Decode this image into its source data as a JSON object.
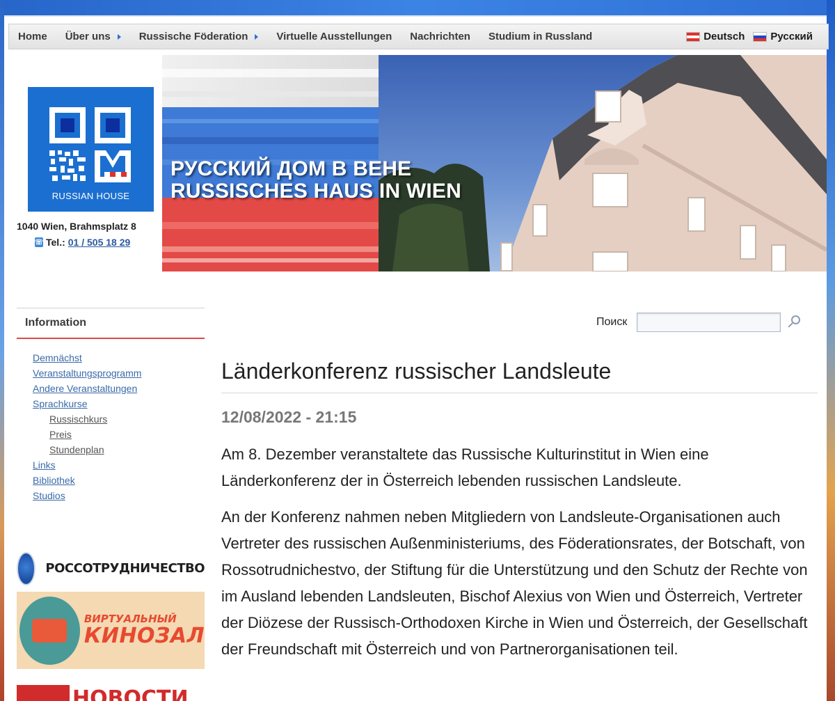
{
  "nav": {
    "items": [
      {
        "label": "Home",
        "has_submenu": false
      },
      {
        "label": "Über uns",
        "has_submenu": true
      },
      {
        "label": "Russische Föderation",
        "has_submenu": true
      },
      {
        "label": "Virtuelle Ausstellungen",
        "has_submenu": false
      },
      {
        "label": "Nachrichten",
        "has_submenu": false
      },
      {
        "label": "Studium in Russland",
        "has_submenu": false
      }
    ],
    "languages": [
      {
        "label": "Deutsch",
        "flag_colors": [
          "#e0312c",
          "#ffffff",
          "#e0312c"
        ]
      },
      {
        "label": "Русский",
        "flag_colors": [
          "#ffffff",
          "#1f46c8",
          "#e0312c"
        ]
      }
    ]
  },
  "header": {
    "logo_text": "RUSSIAN HOUSE",
    "address": "1040 Wien, Brahmsplatz 8",
    "tel_label": "Tel.:",
    "tel_number": "01 / 505 18 29",
    "banner_line1": "РУССКИЙ ДОМ В ВЕНЕ",
    "banner_line2": "RUSSISCHES HAUS IN WIEN"
  },
  "sidebar": {
    "heading": "Information",
    "links": [
      {
        "label": "Demnächst",
        "sub": false
      },
      {
        "label": "Veranstaltungsprogramm",
        "sub": false
      },
      {
        "label": "Andere Veranstaltungen",
        "sub": false
      },
      {
        "label": "Sprachkurse",
        "sub": false
      },
      {
        "label": "Russischkurs",
        "sub": true
      },
      {
        "label": "Preis",
        "sub": true
      },
      {
        "label": "Stundenplan",
        "sub": true
      },
      {
        "label": "Links",
        "sub": false
      },
      {
        "label": "Bibliothek",
        "sub": false
      },
      {
        "label": "Studios",
        "sub": false
      }
    ],
    "partners": {
      "rossotrud": "РОССОТРУДНИЧЕСТВО",
      "kino_line1": "ВИРТУАЛЬНЫЙ",
      "kino_line2": "КИНОЗАЛ",
      "novosti": "НОВОСТИ"
    }
  },
  "search": {
    "label": "Поиск",
    "value": ""
  },
  "article": {
    "title": "Länderkonferenz russischer Landsleute",
    "date": "12/08/2022 - 21:15",
    "paragraphs": [
      "Am 8. Dezember veranstaltete das Russische Kulturinstitut in Wien eine Länderkonferenz der in Österreich lebenden russischen Landsleute.",
      "An der Konferenz nahmen neben Mitgliedern von Landsleute-Organisationen auch Vertreter des russischen Außenministeriums, des Föderationsrates, der Botschaft, von Rossotrudnichestvo, der Stiftung für die Unterstützung und den Schutz der Rechte von im Ausland lebenden Landsleuten, Bischof Alexius von Wien und Österreich, Vertreter der Diözese der Russisch-Orthodoxen Kirche in Wien und Österreich, der Gesellschaft der Freundschaft mit Österreich und von Partnerorganisationen teil."
    ]
  },
  "colors": {
    "accent_red": "#e04848",
    "link_blue": "#3a6aa8",
    "logo_blue": "#1b6fd0"
  }
}
